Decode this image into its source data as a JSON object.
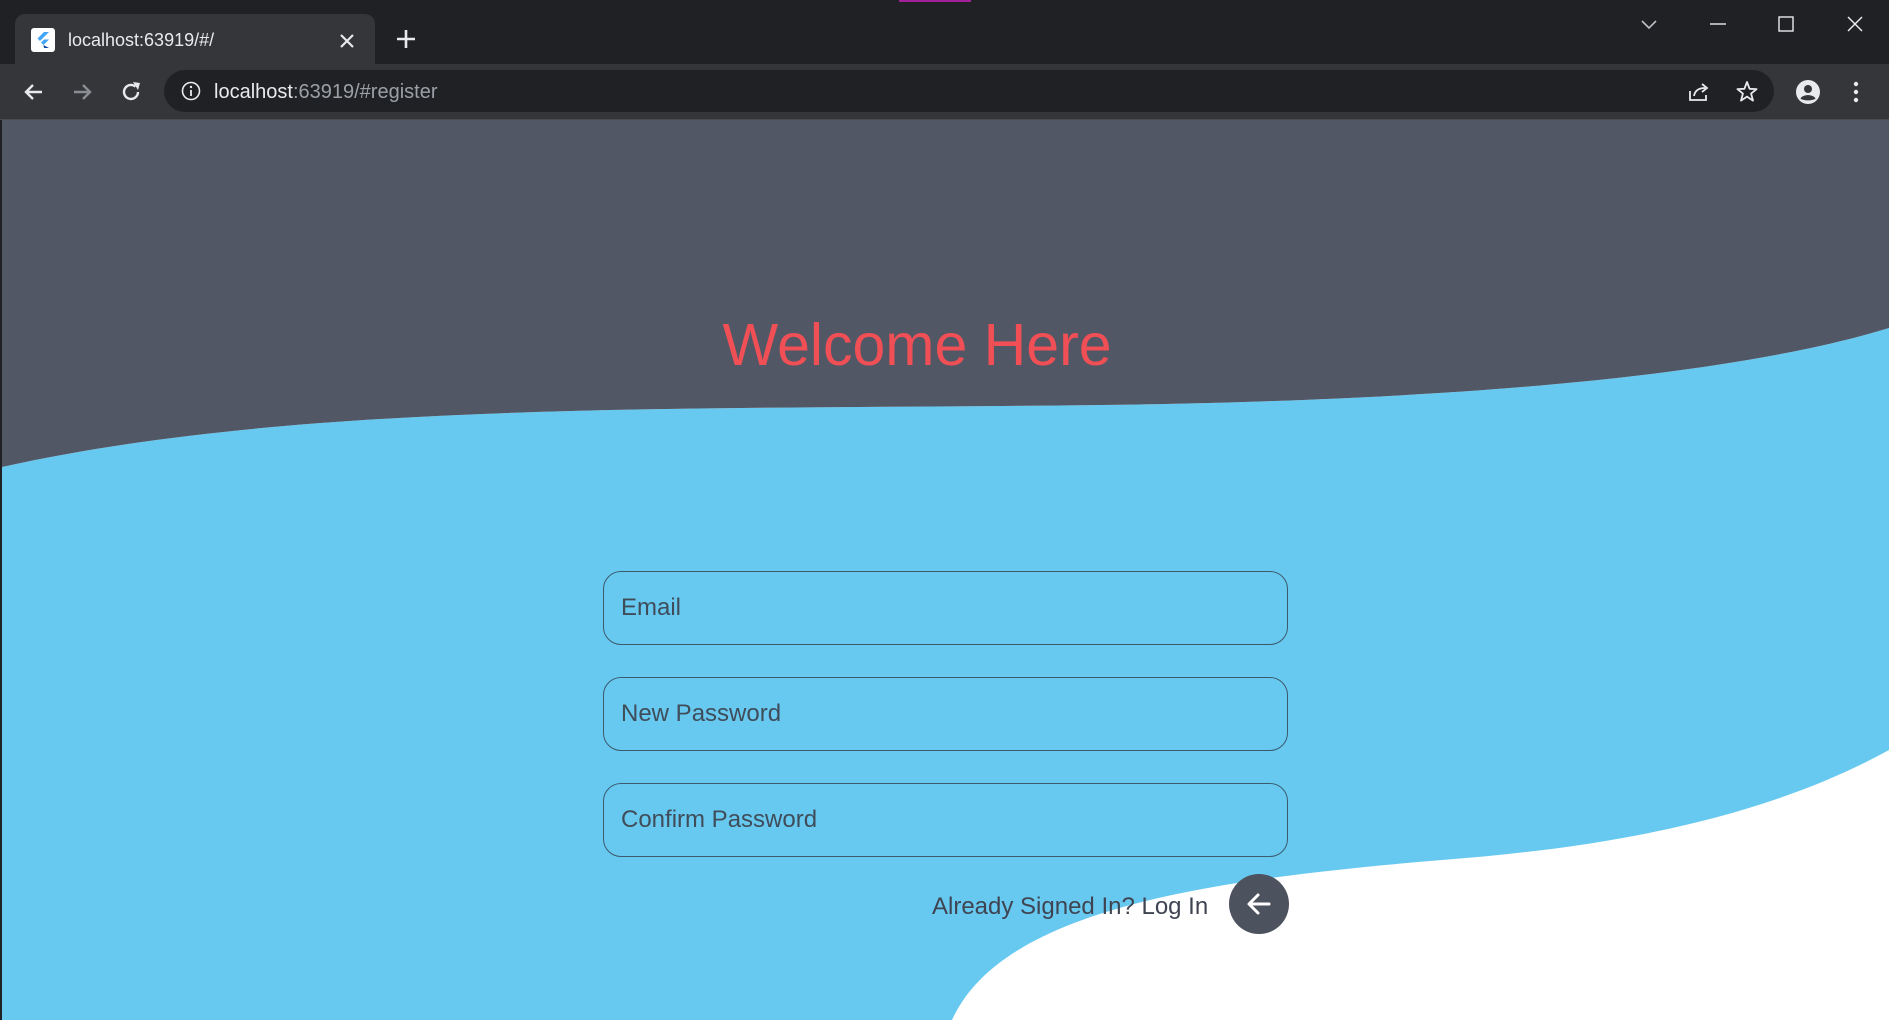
{
  "browser": {
    "tab": {
      "title": "localhost:63919/#/",
      "favicon": "flutter-icon"
    },
    "url_host": "localhost",
    "url_rest": ":63919/#register",
    "icons": {
      "back": "back-arrow-icon",
      "forward": "forward-arrow-icon",
      "reload": "reload-icon",
      "info": "info-icon",
      "share": "share-icon",
      "bookmark": "star-icon",
      "profile": "profile-icon",
      "menu": "kebab-menu-icon"
    }
  },
  "page": {
    "welcome_title": "Welcome Here",
    "form": {
      "email_placeholder": "Email",
      "new_password_placeholder": "New Password",
      "confirm_password_placeholder": "Confirm Password"
    },
    "login_link": "Already Signed In? Log In",
    "back_button_icon": "left-arrow-icon"
  },
  "colors": {
    "header_bg": "#525766",
    "wave_blue": "#68c9f0",
    "bottom_white": "#ffffff",
    "title_red": "#ef4f55",
    "fab_bg": "#4d525f"
  }
}
